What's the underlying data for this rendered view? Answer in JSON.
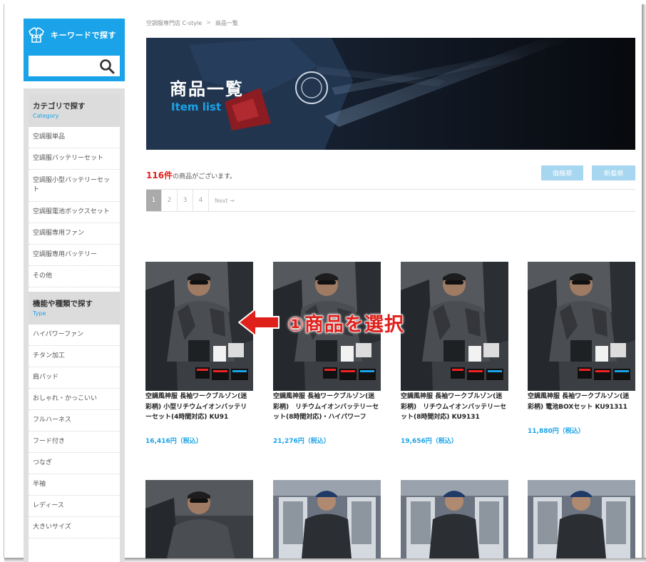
{
  "sidebar": {
    "keyword": {
      "title": "キーワードで探す",
      "input_value": "",
      "icon": "jacket-icon",
      "search_icon": "search-icon"
    },
    "category": {
      "title": "カテゴリで探す",
      "subtitle": "Category",
      "items": [
        "空調服単品",
        "空調服バッテリーセット",
        "空調服小型バッテリーセット",
        "空調服電池ボックスセット",
        "空調服専用ファン",
        "空調服専用バッテリー",
        "その他"
      ]
    },
    "type": {
      "title": "機能や種類で探す",
      "subtitle": "Type",
      "items": [
        "ハイパワーファン",
        "チタン加工",
        "肩パッド",
        "おしゃれ・かっこいい",
        "フルハーネス",
        "フード付き",
        "つなぎ",
        "半袖",
        "レディース",
        "大きいサイズ"
      ]
    }
  },
  "breadcrumb": {
    "home": "空調服専門店 C-style",
    "separator": ">",
    "current": "商品一覧"
  },
  "hero": {
    "title": "商品一覧",
    "subtitle": "Item list"
  },
  "result": {
    "count": "116件",
    "suffix": "の商品がございます。"
  },
  "sort": {
    "price": "価格順",
    "newest": "新着順"
  },
  "pager": {
    "pages": [
      "1",
      "2",
      "3",
      "4"
    ],
    "active": "1",
    "next": "Next →"
  },
  "products": [
    {
      "name": "空調風神服 長袖ワークブルゾン(迷彩柄) 小型リチウムイオンバッテリーセット(4時間対応) KU91",
      "price": "16,416円（税込）"
    },
    {
      "name": "空調風神服 長袖ワークブルゾン(迷彩柄)　リチウムイオンバッテリーセット(8時間対応)・ハイパワーフ",
      "price": "21,276円（税込）"
    },
    {
      "name": "空調風神服 長袖ワークブルゾン(迷彩柄)　リチウムイオンバッテリーセット(8時間対応) KU9131",
      "price": "19,656円（税込）"
    },
    {
      "name": "空調風神服 長袖ワークブルゾン(迷彩柄) 電池BOXセット KU91311",
      "price": "11,880円（税込）"
    }
  ],
  "annotation": {
    "text": "①商品を選択",
    "color": "#e0201b"
  },
  "colors": {
    "accent": "#1aa3e8",
    "count_red": "#e1201c"
  }
}
